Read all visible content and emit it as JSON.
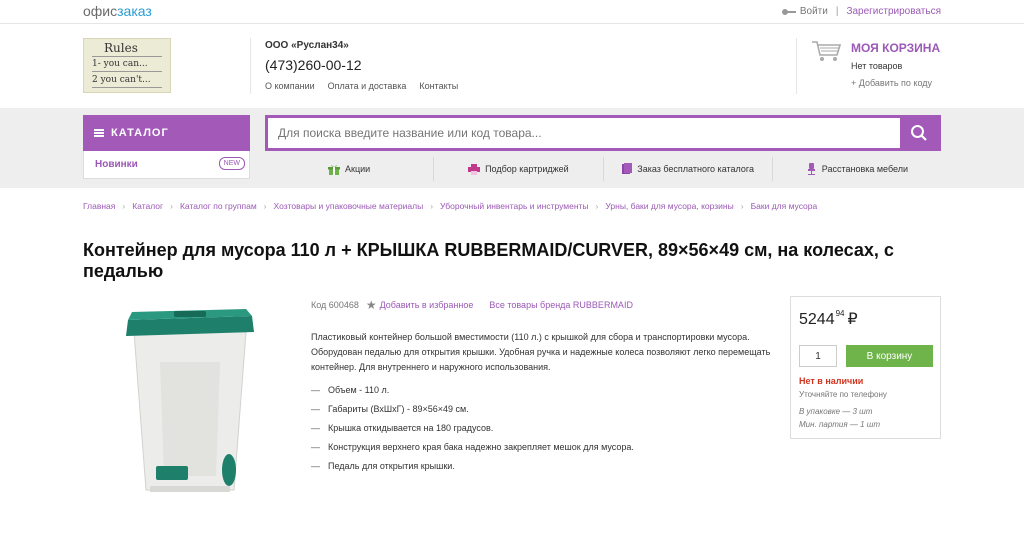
{
  "brand": {
    "part1": "офис",
    "part2": "заказ"
  },
  "auth": {
    "login": "Войти",
    "separator": "|",
    "register": "Зарегистрироваться"
  },
  "logo": {
    "line1": "Rules",
    "line2": "1- you can...",
    "line3": "2 you can't..."
  },
  "company": {
    "name": "ООО «Руслан34»",
    "phone": "(473)260-00-12",
    "links": [
      "О компании",
      "Оплата и доставка",
      "Контакты"
    ]
  },
  "cart": {
    "title": "МОЯ КОРЗИНА",
    "status": "Нет товаров",
    "add_by_code": "+ Добавить по коду"
  },
  "catalog": {
    "label": "КАТАЛОГ",
    "new_label": "Новинки",
    "new_badge": "NEW"
  },
  "search": {
    "placeholder": "Для поиска введите название или код товара..."
  },
  "nav": [
    "Акции",
    "Подбор картриджей",
    "Заказ бесплатного каталога",
    "Расстановка мебели"
  ],
  "breadcrumb": [
    "Главная",
    "Каталог",
    "Каталог по группам",
    "Хозтовары и упаковочные материалы",
    "Уборочный инвентарь и инструменты",
    "Урны, баки для мусора, корзины",
    "Баки для мусора"
  ],
  "product": {
    "title": "Контейнер для мусора 110 л + КРЫШКА RUBBERMAID/CURVER, 89×56×49 см, на колесах, с педалью",
    "code": "Код 600468",
    "favorite": "Добавить в избранное",
    "brand_link": "Все товары бренда RUBBERMAID",
    "description": "Пластиковый контейнер большой вместимости (110 л.) с крышкой для сбора и транспортировки мусора. Оборудован педалью для открытия крышки. Удобная ручка и надежные колеса позволяют легко перемещать контейнер. Для внутреннего и наружного использования.",
    "features": [
      "Объем - 110 л.",
      "Габариты (ВхШхГ) - 89×56×49 см.",
      "Крышка откидывается на 180 градусов.",
      "Конструкция верхнего края бака надежно закрепляет мешок для мусора.",
      "Педаль для открытия крышки."
    ]
  },
  "buy": {
    "price_main": "5244",
    "price_cents": "94",
    "currency": "₽",
    "qty": "1",
    "add_to_cart": "В корзину",
    "stock": "Нет в наличии",
    "clarify": "Уточняйте по телефону",
    "pack": "В упаковке — 3 шт",
    "min_batch": "Мин. партия — 1 шт"
  },
  "colors": {
    "accent": "#a259b8",
    "cart_button": "#6fb34b",
    "out_of_stock": "#d0341f",
    "container_lid": "#1e7f6b"
  }
}
